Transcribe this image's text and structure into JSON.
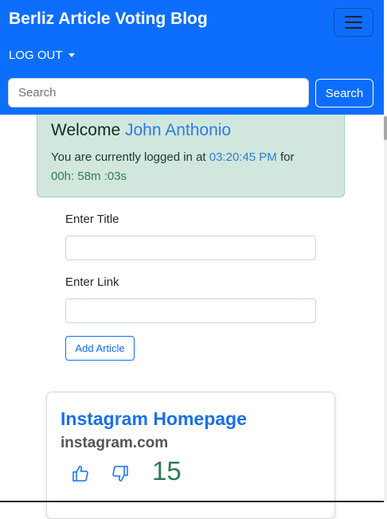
{
  "navbar": {
    "brand": "Berliz Article Voting Blog",
    "logout_label": "LOG OUT",
    "search_placeholder": "Search",
    "search_button": "Search",
    "menu_icon": "hamburger-menu-icon",
    "bg_color": "#0d6efd"
  },
  "welcome": {
    "greeting": "Welcome",
    "user_name": "John Anthonio",
    "logged_prefix": "You are currently logged in at",
    "login_time": "03:20:45 PM",
    "for_word": "for",
    "duration": "00h: 58m :03s"
  },
  "form": {
    "title_label": "Enter Title",
    "title_value": "",
    "link_label": "Enter Link",
    "link_value": "",
    "add_button": "Add Article"
  },
  "articles": [
    {
      "title": "Instagram Homepage",
      "domain": "instagram.com",
      "votes": "15",
      "upvote_icon": "thumbs-up-icon",
      "downvote_icon": "thumbs-down-icon"
    }
  ]
}
